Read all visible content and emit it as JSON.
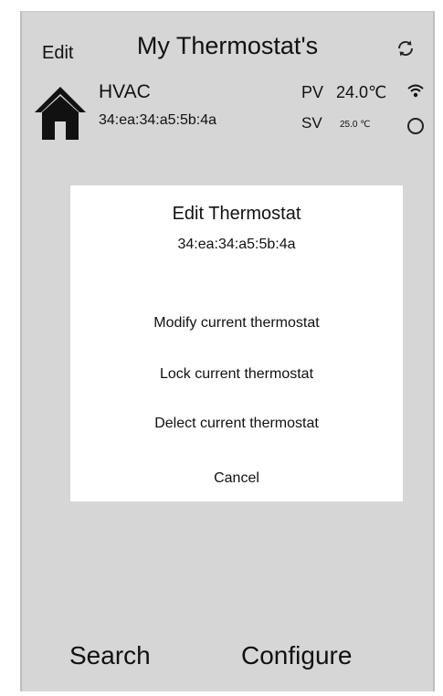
{
  "header": {
    "edit_label": "Edit",
    "title": "My Thermostat's",
    "refresh_icon": "refresh-icon"
  },
  "device": {
    "icon": "house-icon",
    "name": "HVAC",
    "mac": "34:ea:34:a5:5b:4a",
    "pv_label": "PV",
    "pv_value": "24.0℃",
    "sv_label": "SV",
    "sv_value": "25.0 ℃",
    "wifi_icon": "wifi-icon"
  },
  "modal": {
    "title": "Edit Thermostat",
    "subtitle": "34:ea:34:a5:5b:4a",
    "options": [
      "Modify current thermostat",
      "Lock current thermostat",
      "Delect current thermostat",
      "Cancel"
    ]
  },
  "bottom": {
    "search_label": "Search",
    "configure_label": "Configure"
  }
}
